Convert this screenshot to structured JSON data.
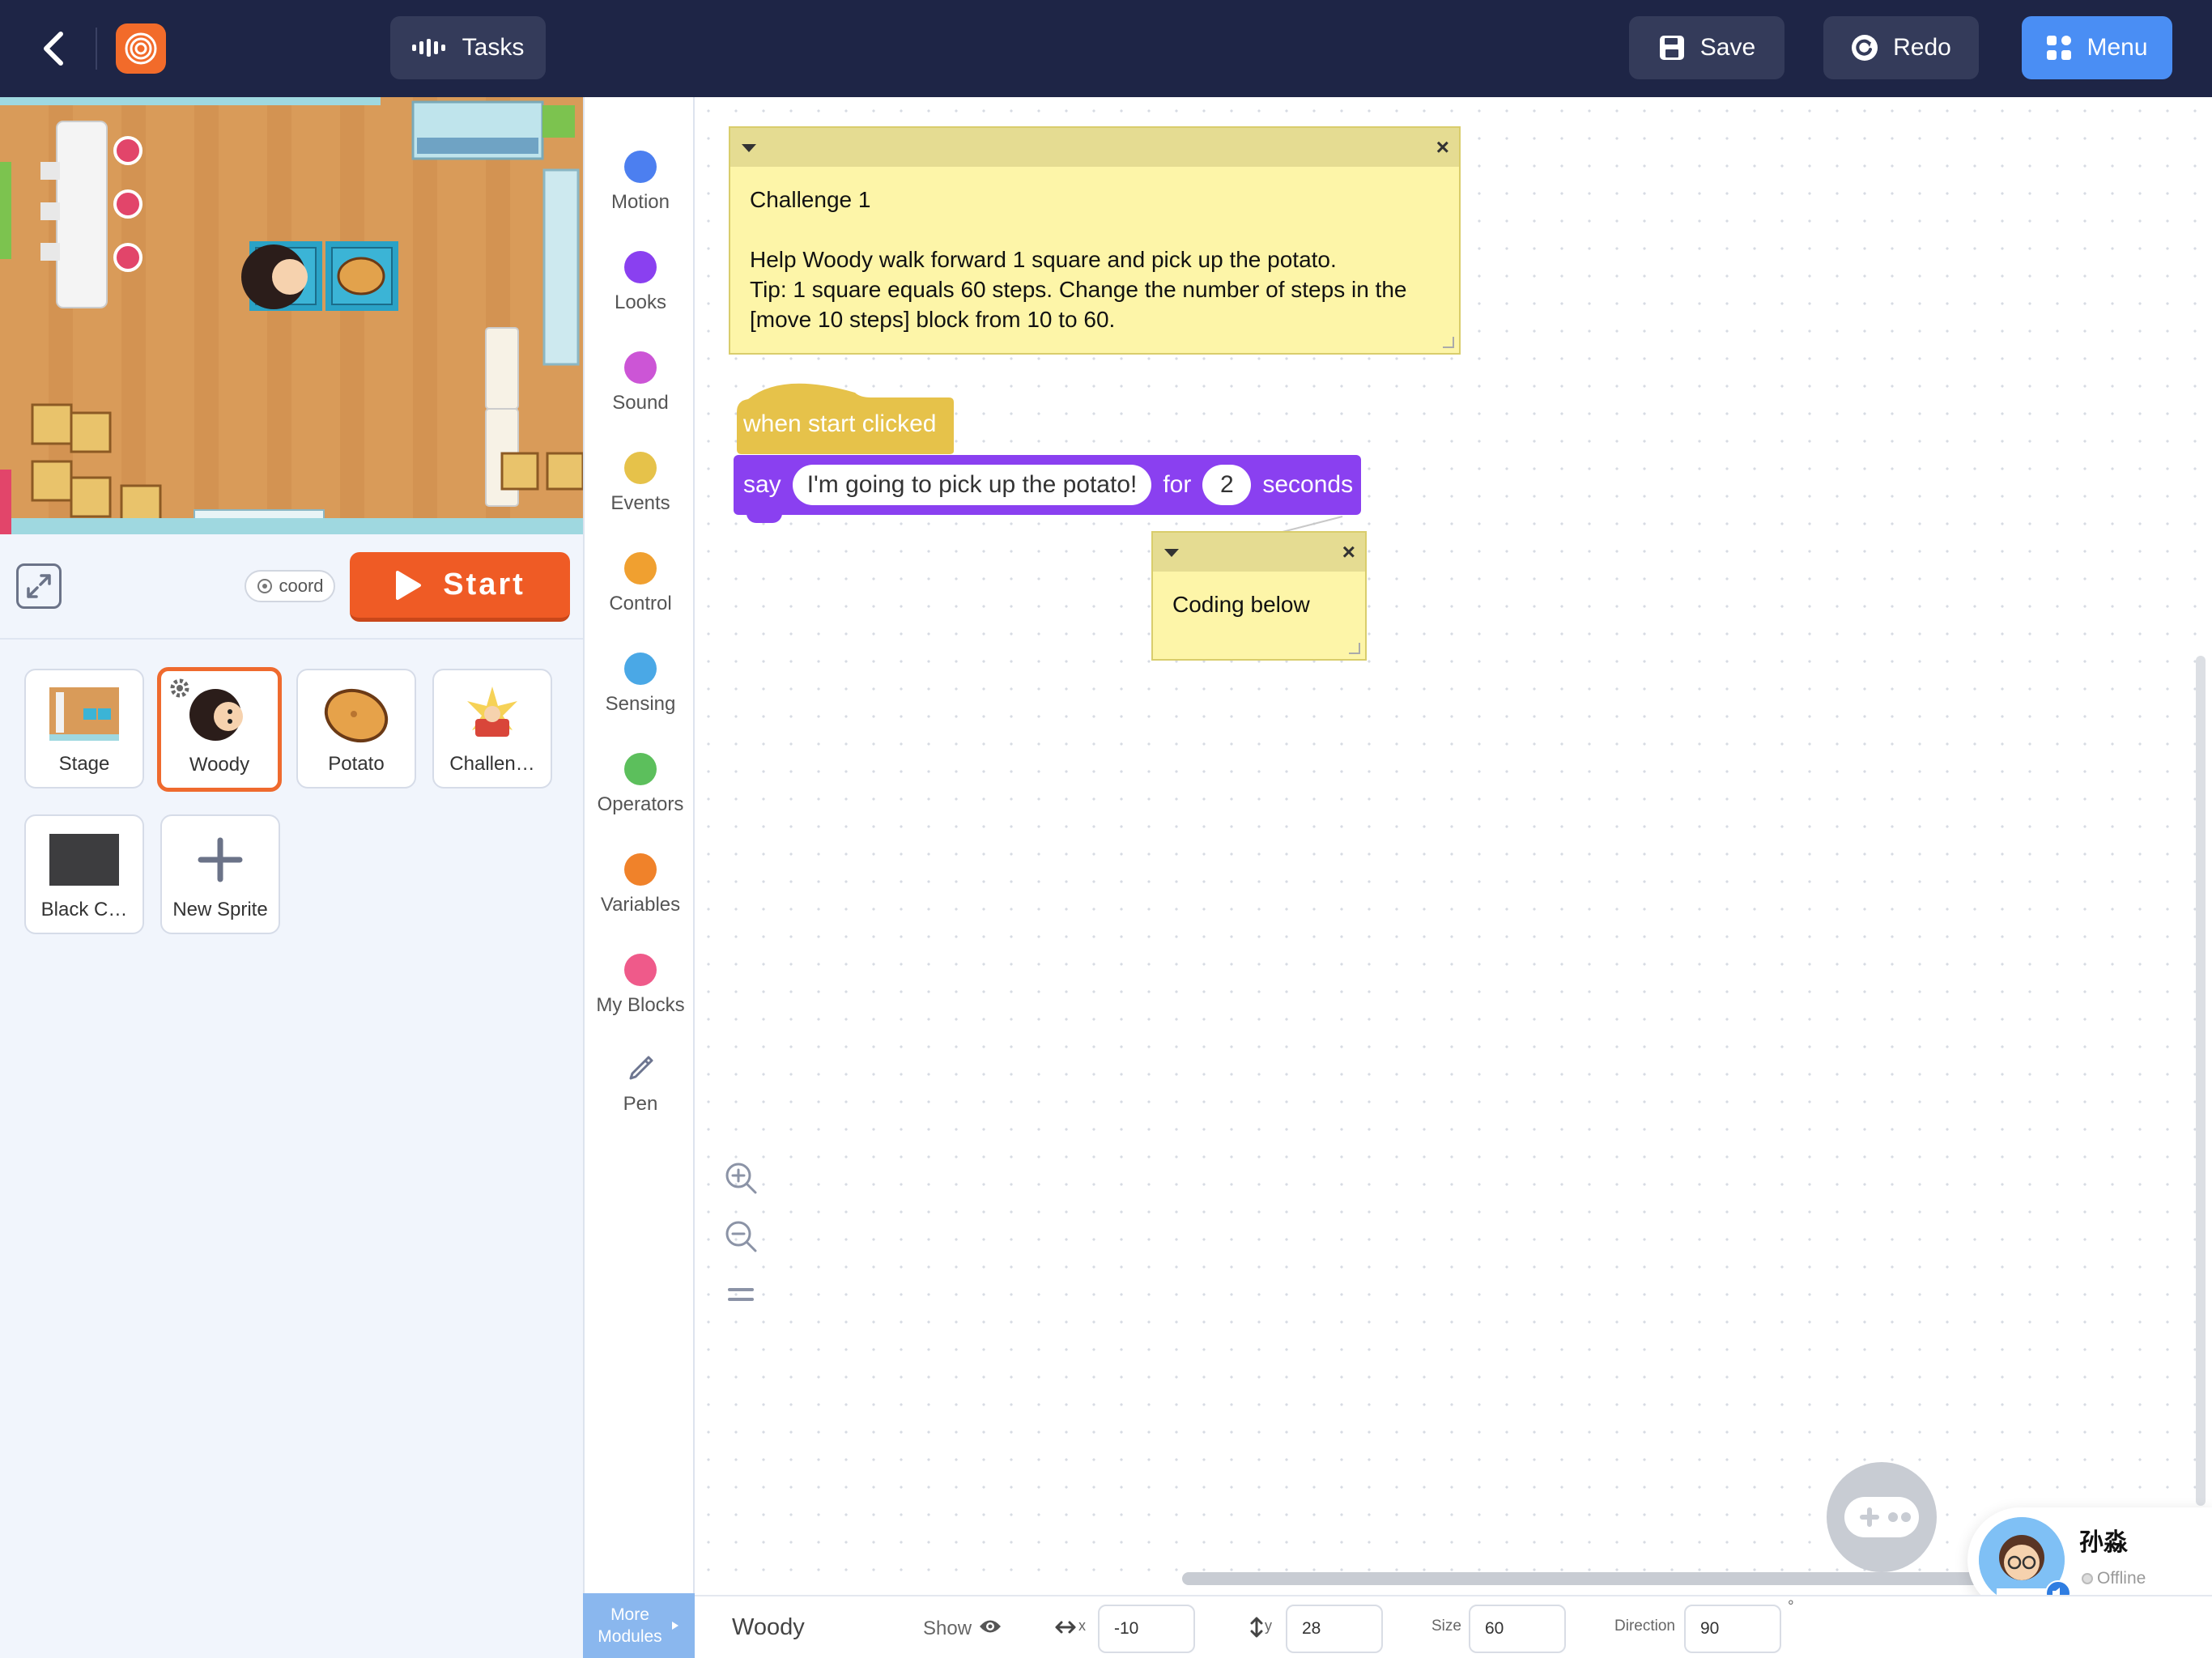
{
  "topbar": {
    "tasks_label": "Tasks",
    "save_label": "Save",
    "redo_label": "Redo",
    "menu_label": "Menu"
  },
  "stage_controls": {
    "coord_label": "coord",
    "start_label": "Start"
  },
  "sprites": [
    {
      "name": "Stage",
      "selected": false
    },
    {
      "name": "Woody",
      "selected": true
    },
    {
      "name": "Potato",
      "selected": false
    },
    {
      "name": "Challen…",
      "selected": false
    },
    {
      "name": "Black C…",
      "selected": false
    },
    {
      "name": "New Sprite",
      "selected": false
    }
  ],
  "categories": [
    {
      "label": "Motion",
      "color": "#4c7ff0"
    },
    {
      "label": "Looks",
      "color": "#8a40f0"
    },
    {
      "label": "Sound",
      "color": "#cc55d6"
    },
    {
      "label": "Events",
      "color": "#e6c24a"
    },
    {
      "label": "Control",
      "color": "#f0a030"
    },
    {
      "label": "Sensing",
      "color": "#4aa8e6"
    },
    {
      "label": "Operators",
      "color": "#5cbf5c"
    },
    {
      "label": "Variables",
      "color": "#f0822a"
    },
    {
      "label": "My Blocks",
      "color": "#ef5a8a"
    },
    {
      "label": "Pen",
      "color": "#6d7590"
    }
  ],
  "more_modules": {
    "line1": "More",
    "line2": "Modules"
  },
  "notes": {
    "challenge": {
      "title": "Challenge 1",
      "line1": "Help Woody walk forward 1 square and pick up the potato.",
      "line2": "Tip: 1 square equals 60 steps. Change the number of steps in the",
      "line3": "[move 10 steps] block from 10 to 60."
    },
    "coding": {
      "text": "Coding below"
    }
  },
  "blocks": {
    "hat": {
      "label": "when start clicked",
      "color": "#e6c24a"
    },
    "say": {
      "say_label": "say",
      "message": "I'm going to pick up the potato!",
      "for_label": "for",
      "seconds_value": "2",
      "seconds_label": "seconds",
      "color": "#8a40f0"
    }
  },
  "user": {
    "name": "孙淼",
    "status": "Offline"
  },
  "properties": {
    "sprite_name": "Woody",
    "show_label": "Show",
    "x_label": "x",
    "x_value": "-10",
    "y_label": "y",
    "y_value": "28",
    "size_label": "Size",
    "size_value": "60",
    "direction_label": "Direction",
    "direction_value": "90",
    "degree_symbol": "°"
  },
  "colors": {
    "topbar_bg": "#1e2546",
    "accent_orange": "#ef5b25",
    "menu_blue": "#4a8ef4"
  }
}
